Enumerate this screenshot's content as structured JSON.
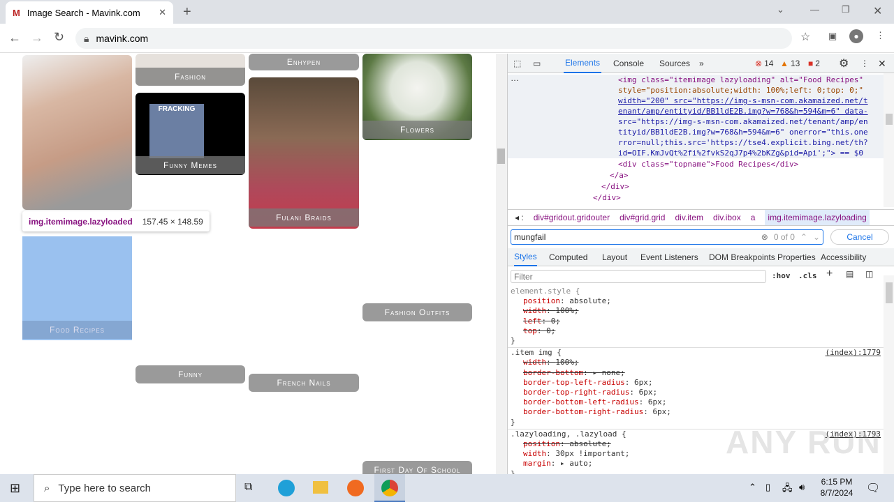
{
  "browser": {
    "tab_title": "Image Search - Mavink.com",
    "url": "mavink.com"
  },
  "page": {
    "tiles": [
      {
        "label": "",
        "color": "#c9a48f"
      },
      {
        "label": "Food Recipes"
      },
      {
        "label": "Fashion"
      },
      {
        "label": "Funny Memes"
      },
      {
        "label": "Funny"
      },
      {
        "label": "Enhypen"
      },
      {
        "label": "Fulani Braids"
      },
      {
        "label": "French Nails"
      },
      {
        "label": "Flowers"
      },
      {
        "label": "Fashion Outfits"
      },
      {
        "label": "First Day Of School"
      }
    ],
    "meme_text": "FRACKING",
    "tooltip": {
      "selector": "img.itemimage.lazyloaded",
      "size": "157.45 × 148.59"
    }
  },
  "devtools": {
    "tabs": [
      "Elements",
      "Console",
      "Sources"
    ],
    "errors": "14",
    "warnings": "13",
    "issues": "2",
    "code_lines": [
      "<img class=\"itemimage lazyloading\" alt=\"Food Recipes\"",
      "style=\"position:absolute;width: 100%;left: 0;top: 0;\"",
      "width=\"200\" src=\"https://img-s-msn-com.akamaized.net/t",
      "enant/amp/entityid/BB1ldE2B.img?w=768&h=594&m=6\" data-",
      "src=\"https://img-s-msn-com.akamaized.net/tenant/amp/en",
      "tityid/BB1ldE2B.img?w=768&h=594&m=6\" onerror=\"this.one",
      "rror=null;this.src='https://tse4.explicit.bing.net/th?",
      "id=OIF.KmJvQt%2fi%2fvkS2qJ7p4%2bKZg&pid=Api';\"> == $0",
      "<div class=\"topname\">Food Recipes</div>",
      "</a>",
      "</div>",
      "</div>"
    ],
    "breadcrumbs": [
      "div#gridout.gridouter",
      "div#grid.grid",
      "div.item",
      "div.ibox",
      "a",
      "img.itemimage.lazyloading"
    ],
    "search": {
      "value": "mungfail",
      "count": "0 of 0",
      "cancel": "Cancel"
    },
    "subtabs": [
      "Styles",
      "Computed",
      "Layout",
      "Event Listeners",
      "DOM Breakpoints",
      "Properties",
      "Accessibility"
    ],
    "filter_placeholder": "Filter",
    "hov": ":hov",
    "cls": ".cls",
    "rules": [
      {
        "selector": "element.style {",
        "source": "",
        "props": [
          [
            "position",
            "absolute;",
            false
          ],
          [
            "width",
            "100%;",
            true
          ],
          [
            "left",
            "0;",
            true
          ],
          [
            "top",
            "0;",
            true
          ]
        ]
      },
      {
        "selector": ".item img {",
        "source": "(index):1779",
        "props": [
          [
            "width",
            "100%;",
            true
          ],
          [
            "border-bottom",
            "▸ none;",
            true
          ],
          [
            "border-top-left-radius",
            "6px;",
            false
          ],
          [
            "border-top-right-radius",
            "6px;",
            false
          ],
          [
            "border-bottom-left-radius",
            "6px;",
            false
          ],
          [
            "border-bottom-right-radius",
            "6px;",
            false
          ]
        ]
      },
      {
        "selector": ".lazyloading, .lazyload {",
        "source": "(index):1793",
        "props": [
          [
            "position",
            "absolute;",
            true
          ],
          [
            "width",
            "30px !important;",
            false
          ],
          [
            "margin",
            "▸ auto;",
            false
          ]
        ]
      }
    ]
  },
  "taskbar": {
    "search_placeholder": "Type here to search",
    "time": "6:15 PM",
    "date": "8/7/2024"
  },
  "watermark": "ANY RUN"
}
